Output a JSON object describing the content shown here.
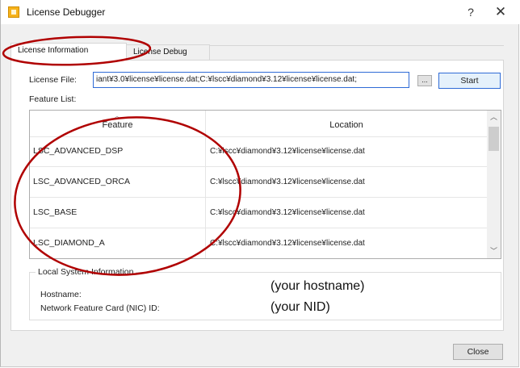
{
  "window": {
    "title": "License Debugger",
    "help_glyph": "?",
    "close_glyph": "✕",
    "app_icon": "license-debugger-app-icon"
  },
  "tabs": [
    {
      "label": "License Information",
      "active": true
    },
    {
      "label": "License Debug",
      "active": false
    }
  ],
  "license_file": {
    "label": "License File:",
    "value": "iant¥3.0¥license¥license.dat;C:¥lscc¥diamond¥3.12¥license¥license.dat;",
    "browse_label": "...",
    "start_label": "Start"
  },
  "feature_list": {
    "label": "Feature List:",
    "columns": [
      "Feature",
      "Location"
    ],
    "rows": [
      {
        "feature": "LSC_ADVANCED_DSP",
        "location": "C:¥lscc¥diamond¥3.12¥license¥license.dat"
      },
      {
        "feature": "LSC_ADVANCED_ORCA",
        "location": "C:¥lscc¥diamond¥3.12¥license¥license.dat"
      },
      {
        "feature": "LSC_BASE",
        "location": "C:¥lscc¥diamond¥3.12¥license¥license.dat"
      },
      {
        "feature": "LSC_DIAMOND_A",
        "location": "C:¥lscc¥diamond¥3.12¥license¥license.dat"
      }
    ]
  },
  "local_system": {
    "legend": "Local System Information",
    "hostname_label": "Hostname:",
    "nid_label": "Network Feature Card (NIC) ID:",
    "hostname_value": "(your hostname)",
    "nid_value": "(your NID)"
  },
  "footer": {
    "close_label": "Close"
  },
  "colors": {
    "annotation": "#b00000",
    "accent": "#2f6bd6"
  }
}
